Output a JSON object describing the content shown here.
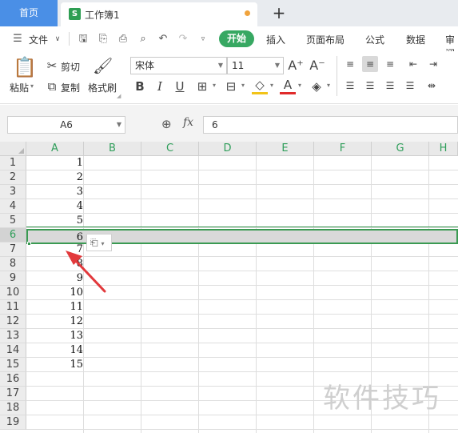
{
  "tabs": {
    "home": "首页",
    "document": "工作簿1",
    "doc_icon": "S",
    "new_tab": "+"
  },
  "menu": {
    "file": "文件",
    "items": [
      "开始",
      "插入",
      "页面布局",
      "公式",
      "数据",
      "审阅"
    ],
    "active": "开始"
  },
  "ribbon": {
    "paste": "粘贴",
    "cut": "剪切",
    "copy": "复制",
    "format_painter": "格式刷",
    "font_name": "宋体",
    "font_size": "11",
    "bold": "B",
    "italic": "I",
    "underline": "U",
    "grow_font": "A⁺",
    "shrink_font": "A⁻"
  },
  "formula_bar": {
    "name_box": "A6",
    "fx": "fx",
    "value": "6"
  },
  "grid": {
    "columns": [
      "A",
      "B",
      "C",
      "D",
      "E",
      "F",
      "G",
      "H"
    ],
    "rows": [
      "1",
      "2",
      "3",
      "4",
      "5",
      "6",
      "7",
      "8",
      "9",
      "10",
      "11",
      "12",
      "13",
      "14",
      "15",
      "16",
      "17",
      "18",
      "19"
    ],
    "column_a_values": [
      "1",
      "2",
      "3",
      "4",
      "5",
      "6",
      "7",
      "8",
      "9",
      "10",
      "11",
      "12",
      "13",
      "14",
      "15"
    ],
    "selected_row": "6"
  },
  "watermark": "软件技巧",
  "colors": {
    "accent_green": "#37a862",
    "home_tab_blue": "#4a8fe6",
    "arrow_red": "#e2393c"
  }
}
